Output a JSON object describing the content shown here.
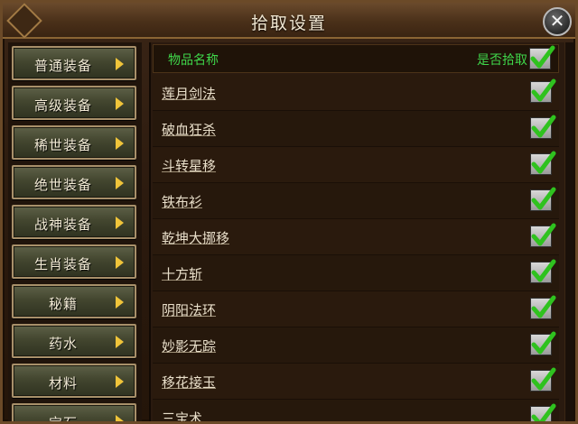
{
  "window": {
    "title": "拾取设置",
    "close_symbol": "✕"
  },
  "categories": [
    {
      "label": "普通装备"
    },
    {
      "label": "高级装备"
    },
    {
      "label": "稀世装备"
    },
    {
      "label": "绝世装备"
    },
    {
      "label": "战神装备"
    },
    {
      "label": "生肖装备"
    },
    {
      "label": "秘籍"
    },
    {
      "label": "药水"
    },
    {
      "label": "材料"
    },
    {
      "label": "宝石"
    }
  ],
  "table": {
    "col_name": "物品名称",
    "col_pickup": "是否拾取",
    "header_checked": true,
    "items": [
      {
        "name": "莲月剑法",
        "checked": true
      },
      {
        "name": "破血狂杀",
        "checked": true
      },
      {
        "name": "斗转星移",
        "checked": true
      },
      {
        "name": "铁布衫",
        "checked": true
      },
      {
        "name": "乾坤大挪移",
        "checked": true
      },
      {
        "name": "十方斩",
        "checked": true
      },
      {
        "name": "阴阳法环",
        "checked": true
      },
      {
        "name": "妙影无踪",
        "checked": true
      },
      {
        "name": "移花接玉",
        "checked": true
      },
      {
        "name": "三宝术",
        "checked": true
      }
    ]
  },
  "colors": {
    "header_text": "#3fd64a",
    "check_green": "#2fc21f",
    "arrow_gold": "#f0c43a"
  }
}
